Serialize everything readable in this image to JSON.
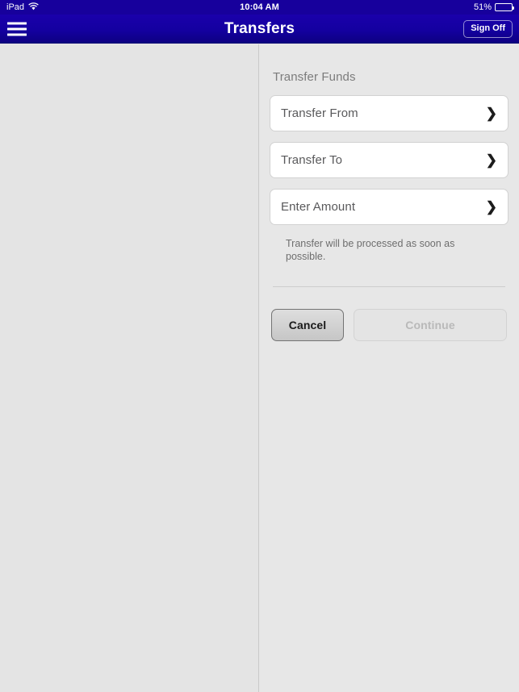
{
  "status_bar": {
    "device": "iPad",
    "wifi_icon": "wifi-icon",
    "time": "10:04 AM",
    "battery_percent": "51%",
    "battery_icon": "battery-icon"
  },
  "nav_bar": {
    "menu_icon": "hamburger-menu-icon",
    "title": "Transfers",
    "sign_off_label": "Sign Off"
  },
  "detail": {
    "section_title": "Transfer Funds",
    "fields": [
      {
        "label": "Transfer From",
        "chevron": "❯",
        "icon": "chevron-right-icon"
      },
      {
        "label": "Transfer To",
        "chevron": "❯",
        "icon": "chevron-right-icon"
      },
      {
        "label": "Enter Amount",
        "chevron": "❯",
        "icon": "chevron-right-icon"
      }
    ],
    "helper_note": "Transfer will be processed as soon as possible.",
    "cancel_label": "Cancel",
    "continue_label": "Continue"
  },
  "colors": {
    "nav_blue": "#1400a0",
    "panel_gray": "#e7e7e7",
    "card_white": "#ffffff",
    "text_gray": "#6e6e6e",
    "disabled_text": "#b9b9b9"
  }
}
